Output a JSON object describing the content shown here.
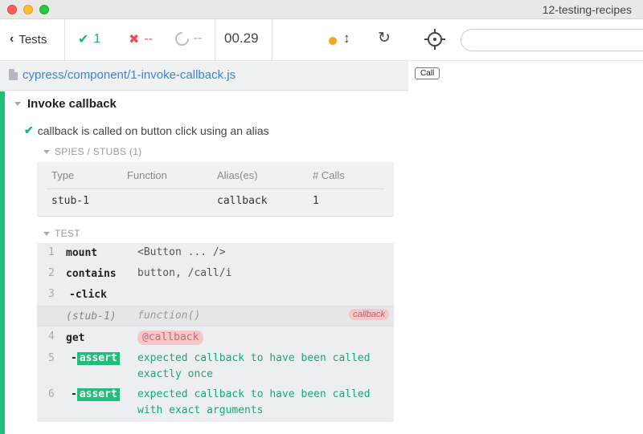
{
  "window": {
    "title": "12-testing-recipes"
  },
  "stats": {
    "tests_label": "Tests",
    "passed": "1",
    "failed": "--",
    "pending": "--",
    "duration": "00.29"
  },
  "spec": {
    "path": "cypress/component/1-invoke-callback.js"
  },
  "suite": {
    "title": "Invoke callback",
    "test_title": "callback is called on button click using an alias"
  },
  "spies": {
    "header": "SPIES / STUBS (1)",
    "columns": [
      "Type",
      "Function",
      "Alias(es)",
      "# Calls"
    ],
    "rows": [
      {
        "type": "stub-1",
        "function": "",
        "alias": "callback",
        "calls": "1"
      }
    ]
  },
  "test_section": {
    "header": "TEST",
    "commands": [
      {
        "num": "1",
        "name": "mount",
        "message": "<Button ... />"
      },
      {
        "num": "2",
        "name": "contains",
        "message": "button, /call/i"
      },
      {
        "num": "3",
        "name": "-click",
        "message": ""
      },
      {
        "num": "",
        "name": "(stub-1)",
        "message": "function()",
        "badge": "callback"
      },
      {
        "num": "4",
        "name": "get",
        "message": "@callback"
      },
      {
        "num": "5",
        "prefix": "-",
        "tag": "assert",
        "message_line1": "expected callback to have been called",
        "message_line2": "exactly once"
      },
      {
        "num": "6",
        "prefix": "-",
        "tag": "assert",
        "message_line1": "expected callback to have been called",
        "message_line2": "with exact arguments"
      }
    ]
  },
  "aut": {
    "button_label": "Call"
  },
  "colors": {
    "pass": "#1bb57a",
    "fail": "#e94f5a",
    "link": "#3a85d8",
    "alias": "#f7c6c8"
  }
}
